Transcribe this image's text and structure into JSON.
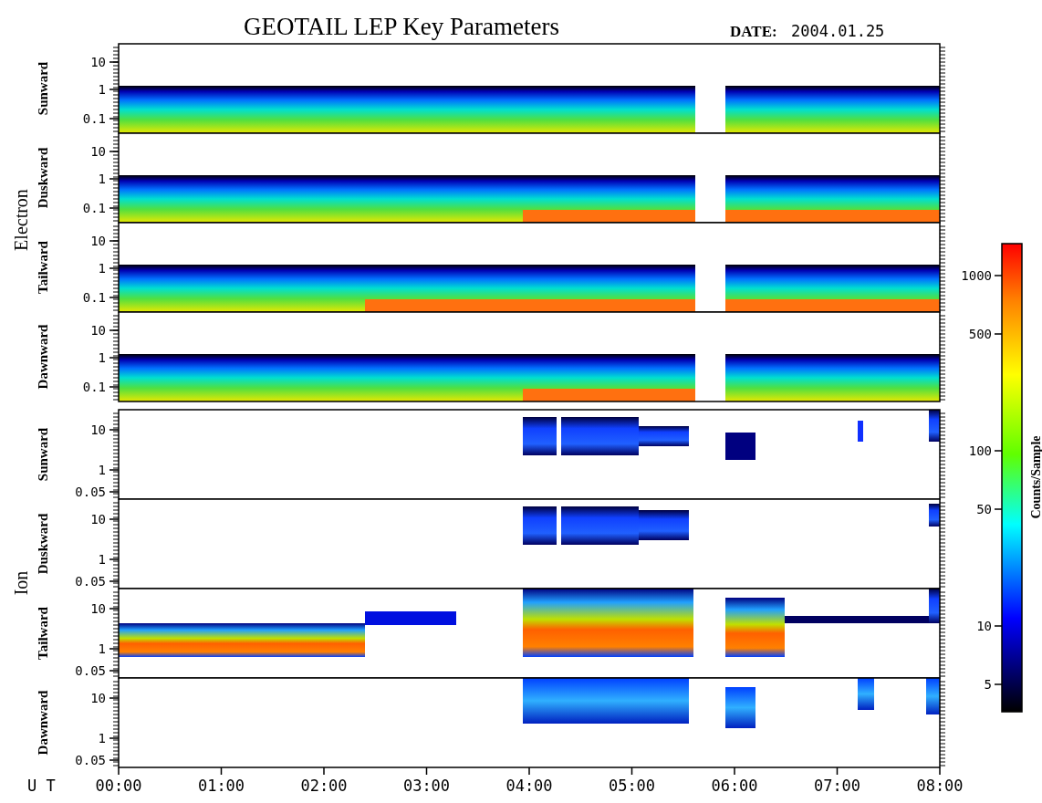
{
  "title": "GEOTAIL LEP Key Parameters",
  "date_label": "DATE:",
  "date": "2004.01.25",
  "groups": [
    {
      "label": "Electron",
      "panels": [
        {
          "label": "Sunward",
          "yticks": [
            "10",
            "1",
            "0.1"
          ]
        },
        {
          "label": "Duskward",
          "yticks": [
            "10",
            "1",
            "0.1"
          ]
        },
        {
          "label": "Tailward",
          "yticks": [
            "10",
            "1",
            "0.1"
          ]
        },
        {
          "label": "Dawnward",
          "yticks": [
            "10",
            "1",
            "0.1"
          ]
        }
      ]
    },
    {
      "label": "Ion",
      "panels": [
        {
          "label": "Sunward",
          "yticks": [
            "10",
            "1",
            "0.05"
          ]
        },
        {
          "label": "Duskward",
          "yticks": [
            "10",
            "1",
            "0.05"
          ]
        },
        {
          "label": "Tailward",
          "yticks": [
            "10",
            "1",
            "0.05"
          ]
        },
        {
          "label": "Dawnward",
          "yticks": [
            "10",
            "1",
            "0.05"
          ]
        }
      ]
    }
  ],
  "colorbar": {
    "label": "Counts/Sample",
    "ticks": [
      "1000",
      "500",
      "100",
      "50",
      "10",
      "5"
    ]
  },
  "time_axis": {
    "label": "U T",
    "ticks": [
      "00:00",
      "01:00",
      "02:00",
      "03:00",
      "04:00",
      "05:00",
      "06:00",
      "07:00",
      "08:00"
    ]
  }
}
